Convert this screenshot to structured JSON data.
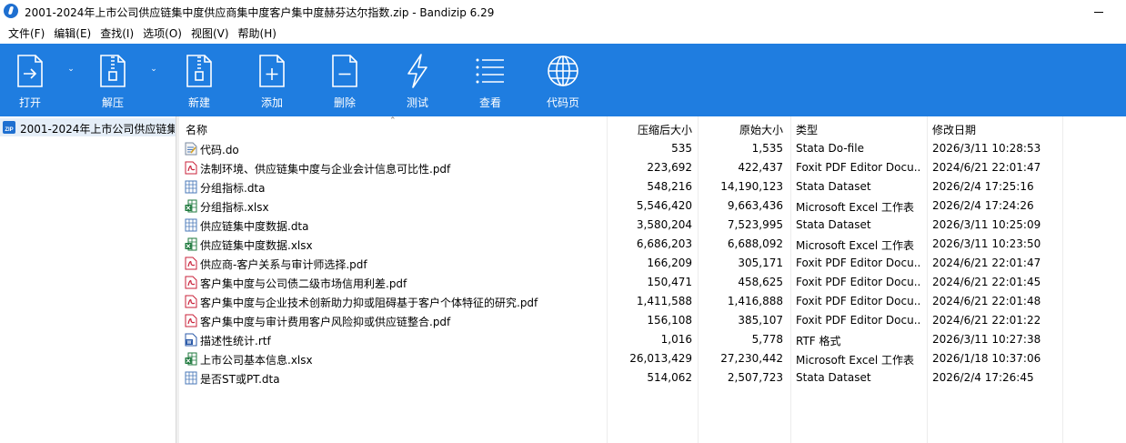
{
  "window": {
    "title": "2001-2024年上市公司供应链集中度供应商集中度客户集中度赫芬达尔指数.zip - Bandizip 6.29"
  },
  "menu": [
    "文件(F)",
    "编辑(E)",
    "查找(I)",
    "选项(O)",
    "视图(V)",
    "帮助(H)"
  ],
  "toolbar": {
    "open": "打开",
    "extract": "解压",
    "new": "新建",
    "add": "添加",
    "delete": "删除",
    "test": "测试",
    "view": "查看",
    "codepage": "代码页"
  },
  "tree": {
    "root_label": "2001-2024年上市公司供应链集"
  },
  "list": {
    "headers": {
      "name": "名称",
      "compressed": "压缩后大小",
      "original": "原始大小",
      "type": "类型",
      "modified": "修改日期"
    },
    "rows": [
      {
        "name": "代码.do",
        "compressed": "535",
        "original": "1,535",
        "type": "Stata Do-file",
        "modified": "2026/3/11 10:28:53",
        "icon": "do-file-icon"
      },
      {
        "name": "法制环境、供应链集中度与企业会计信息可比性.pdf",
        "compressed": "223,692",
        "original": "422,437",
        "type": "Foxit PDF Editor Docu...",
        "modified": "2024/6/21 22:01:47",
        "icon": "pdf-icon"
      },
      {
        "name": "分组指标.dta",
        "compressed": "548,216",
        "original": "14,190,123",
        "type": "Stata Dataset",
        "modified": "2026/2/4 17:25:16",
        "icon": "dta-icon"
      },
      {
        "name": "分组指标.xlsx",
        "compressed": "5,546,420",
        "original": "9,663,436",
        "type": "Microsoft Excel 工作表",
        "modified": "2026/2/4 17:24:26",
        "icon": "excel-icon"
      },
      {
        "name": "供应链集中度数据.dta",
        "compressed": "3,580,204",
        "original": "7,523,995",
        "type": "Stata Dataset",
        "modified": "2026/3/11 10:25:09",
        "icon": "dta-icon"
      },
      {
        "name": "供应链集中度数据.xlsx",
        "compressed": "6,686,203",
        "original": "6,688,092",
        "type": "Microsoft Excel 工作表",
        "modified": "2026/3/11 10:23:50",
        "icon": "excel-icon"
      },
      {
        "name": "供应商-客户关系与审计师选择.pdf",
        "compressed": "166,209",
        "original": "305,171",
        "type": "Foxit PDF Editor Docu...",
        "modified": "2024/6/21 22:01:47",
        "icon": "pdf-icon"
      },
      {
        "name": "客户集中度与公司债二级市场信用利差.pdf",
        "compressed": "150,471",
        "original": "458,625",
        "type": "Foxit PDF Editor Docu...",
        "modified": "2024/6/21 22:01:45",
        "icon": "pdf-icon"
      },
      {
        "name": "客户集中度与企业技术创新助力抑或阻碍基于客户个体特征的研究.pdf",
        "compressed": "1,411,588",
        "original": "1,416,888",
        "type": "Foxit PDF Editor Docu...",
        "modified": "2024/6/21 22:01:48",
        "icon": "pdf-icon"
      },
      {
        "name": "客户集中度与审计费用客户风险抑或供应链整合.pdf",
        "compressed": "156,108",
        "original": "385,107",
        "type": "Foxit PDF Editor Docu...",
        "modified": "2024/6/21 22:01:22",
        "icon": "pdf-icon"
      },
      {
        "name": "描述性统计.rtf",
        "compressed": "1,016",
        "original": "5,778",
        "type": "RTF 格式",
        "modified": "2026/3/11 10:27:38",
        "icon": "rtf-icon"
      },
      {
        "name": "上市公司基本信息.xlsx",
        "compressed": "26,013,429",
        "original": "27,230,442",
        "type": "Microsoft Excel 工作表",
        "modified": "2026/1/18 10:37:06",
        "icon": "excel-icon"
      },
      {
        "name": "是否ST或PT.dta",
        "compressed": "514,062",
        "original": "2,507,723",
        "type": "Stata Dataset",
        "modified": "2026/2/4 17:26:45",
        "icon": "dta-icon"
      }
    ]
  },
  "colors": {
    "toolbar_bg": "#1f7de0",
    "selection_bg": "#e5eef8",
    "pdf_red": "#c9213a",
    "excel_green": "#1f7a3e",
    "dta_blue": "#4a78b8"
  }
}
